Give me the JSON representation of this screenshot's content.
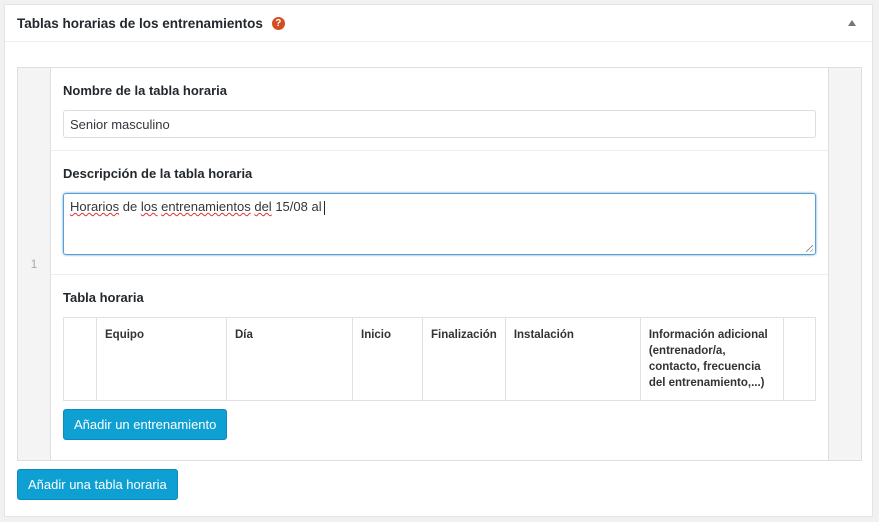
{
  "metabox": {
    "title": "Tablas horarias de los entrenamientos",
    "help_icon": "?"
  },
  "row": {
    "index": "1",
    "name_field": {
      "label": "Nombre de la tabla horaria",
      "value": "Senior masculino"
    },
    "description_field": {
      "label": "Descripción de la tabla horaria",
      "words": [
        "Horarios",
        "de",
        "los",
        "entrenamientos",
        "del",
        "15/08",
        "al"
      ]
    },
    "schedule": {
      "label": "Tabla horaria",
      "columns": [
        "",
        "Equipo",
        "Día",
        "Inicio",
        "Finalización",
        "Instalación",
        "Información adicional (entrenador/a, contacto, frecuencia del entrenamiento,...)",
        ""
      ],
      "add_button": "Añadir un entrenamiento"
    }
  },
  "add_table_button": "Añadir una tabla horaria",
  "colors": {
    "button": "#0ea0d2",
    "help_icon": "#d54e21",
    "focus_border": "#5b9dd9"
  }
}
